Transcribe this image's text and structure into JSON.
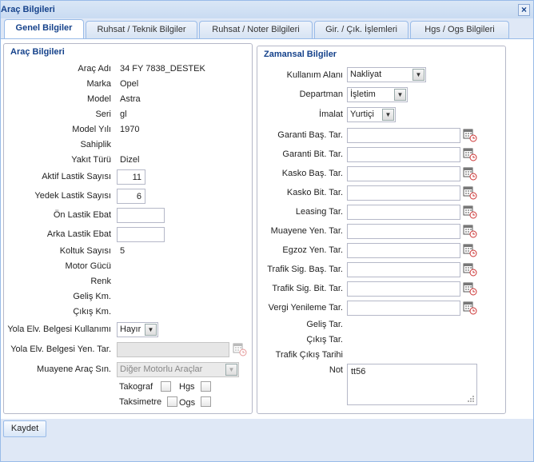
{
  "window": {
    "title": "Araç Bilgileri"
  },
  "tabs": [
    {
      "label": "Genel Bilgiler"
    },
    {
      "label": "Ruhsat / Teknik Bilgiler"
    },
    {
      "label": "Ruhsat / Noter Bilgileri"
    },
    {
      "label": "Gir. / Çık. İşlemleri"
    },
    {
      "label": "Hgs / Ogs Bilgileri"
    }
  ],
  "left": {
    "legend": "Araç Bilgileri",
    "arac_adi": {
      "label": "Araç Adı",
      "value": "34 FY 7838_DESTEK"
    },
    "marka": {
      "label": "Marka",
      "value": "Opel"
    },
    "model": {
      "label": "Model",
      "value": "Astra"
    },
    "seri": {
      "label": "Seri",
      "value": "gl"
    },
    "model_yili": {
      "label": "Model Yılı",
      "value": "1970"
    },
    "sahiplik": {
      "label": "Sahiplik",
      "value": ""
    },
    "yakit": {
      "label": "Yakıt Türü",
      "value": "Dizel"
    },
    "aktif_lastik": {
      "label": "Aktif Lastik Sayısı",
      "value": "11"
    },
    "yedek_lastik": {
      "label": "Yedek Lastik Sayısı",
      "value": "6"
    },
    "on_lastik": {
      "label": "Ön Lastik Ebat",
      "value": ""
    },
    "arka_lastik": {
      "label": "Arka Lastik Ebat",
      "value": ""
    },
    "koltuk": {
      "label": "Koltuk Sayısı",
      "value": "5"
    },
    "motor": {
      "label": "Motor Gücü",
      "value": ""
    },
    "renk": {
      "label": "Renk",
      "value": ""
    },
    "gelis_km": {
      "label": "Geliş Km.",
      "value": ""
    },
    "cikis_km": {
      "label": "Çıkış Km.",
      "value": ""
    },
    "yola_elv": {
      "label": "Yola Elv. Belgesi Kullanımı",
      "value": "Hayır"
    },
    "yola_elv_tar": {
      "label": "Yola Elv. Belgesi Yen. Tar.",
      "value": ""
    },
    "muayene_sin": {
      "label": "Muayene Araç Sın.",
      "value": "Diğer Motorlu Araçlar"
    },
    "takograf": {
      "label": "Takograf"
    },
    "hgs": {
      "label": "Hgs"
    },
    "taksimetre": {
      "label": "Taksimetre"
    },
    "ogs": {
      "label": "Ogs"
    }
  },
  "right": {
    "legend": "Zamansal Bilgiler",
    "kullanim": {
      "label": "Kullanım Alanı",
      "value": "Nakliyat"
    },
    "departman": {
      "label": "Departman",
      "value": "İşletim"
    },
    "imalat": {
      "label": "İmalat",
      "value": "Yurtiçi"
    },
    "dates": [
      {
        "label": "Garanti Baş. Tar.",
        "value": ""
      },
      {
        "label": "Garanti Bit. Tar.",
        "value": ""
      },
      {
        "label": "Kasko Baş. Tar.",
        "value": ""
      },
      {
        "label": "Kasko Bit. Tar.",
        "value": ""
      },
      {
        "label": "Leasing Tar.",
        "value": ""
      },
      {
        "label": "Muayene Yen. Tar.",
        "value": ""
      },
      {
        "label": "Egzoz Yen. Tar.",
        "value": ""
      },
      {
        "label": "Trafik Sig. Baş. Tar.",
        "value": ""
      },
      {
        "label": "Trafik Sig. Bit. Tar.",
        "value": ""
      },
      {
        "label": "Vergi Yenileme Tar.",
        "value": ""
      }
    ],
    "gelis_tar": {
      "label": "Geliş Tar."
    },
    "cikis_tar": {
      "label": "Çıkış Tar."
    },
    "trafik_cikis": {
      "label": "Trafik Çıkış Tarihi"
    },
    "not": {
      "label": "Not",
      "value": "tt56"
    }
  },
  "footer": {
    "save_label": "Kaydet"
  },
  "icons": {
    "calendar": "calendar-icon",
    "close": "close-icon",
    "dropdown": "chevron-down-icon"
  }
}
